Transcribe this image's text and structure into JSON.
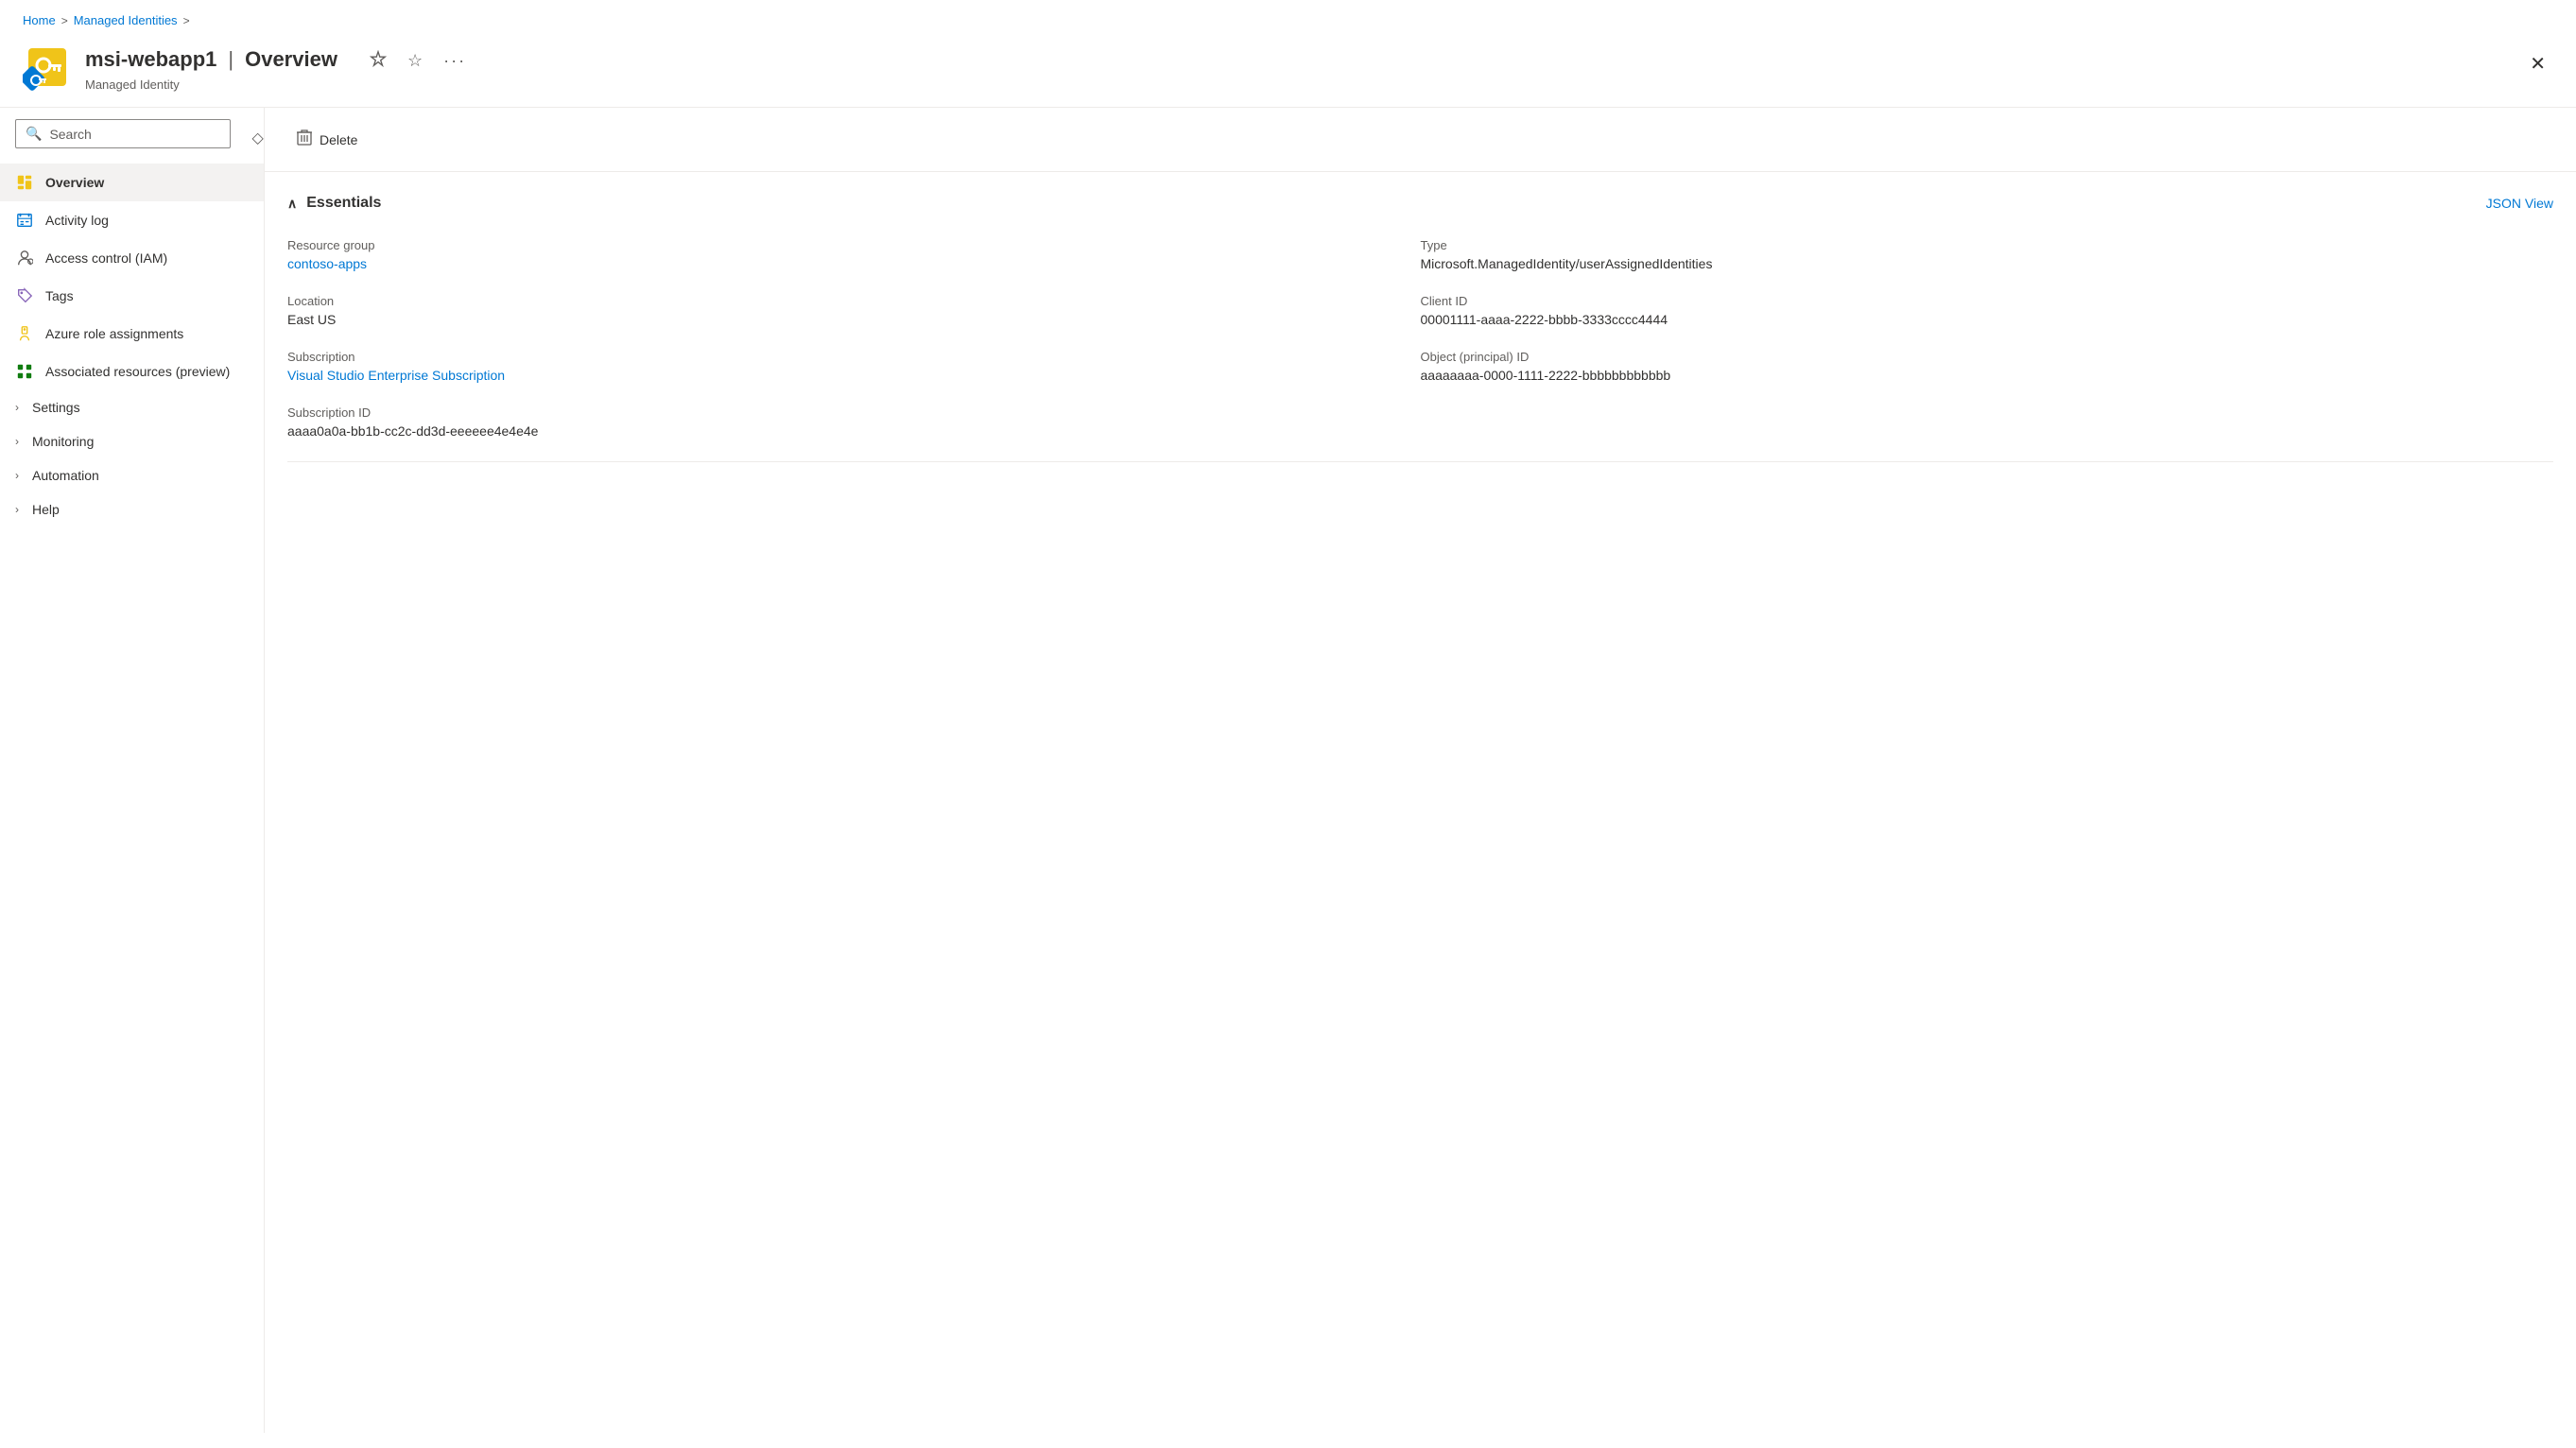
{
  "breadcrumb": {
    "home": "Home",
    "managed_identities": "Managed Identities",
    "sep": ">"
  },
  "header": {
    "title": "msi-webapp1",
    "separator": "|",
    "page": "Overview",
    "subtitle": "Managed Identity",
    "pin_icon": "📌",
    "star_icon": "☆",
    "more_icon": "···",
    "close_icon": "✕"
  },
  "sidebar": {
    "search_placeholder": "Search",
    "nav_items": [
      {
        "id": "overview",
        "label": "Overview",
        "icon": "key",
        "active": true
      },
      {
        "id": "activity-log",
        "label": "Activity log",
        "icon": "list"
      },
      {
        "id": "access-control",
        "label": "Access control (IAM)",
        "icon": "person"
      },
      {
        "id": "tags",
        "label": "Tags",
        "icon": "tag"
      },
      {
        "id": "azure-role-assignments",
        "label": "Azure role assignments",
        "icon": "key-small"
      },
      {
        "id": "associated-resources",
        "label": "Associated resources (preview)",
        "icon": "grid"
      }
    ],
    "expandable_items": [
      {
        "id": "settings",
        "label": "Settings"
      },
      {
        "id": "monitoring",
        "label": "Monitoring"
      },
      {
        "id": "automation",
        "label": "Automation"
      },
      {
        "id": "help",
        "label": "Help"
      }
    ]
  },
  "toolbar": {
    "delete_label": "Delete",
    "delete_icon": "🗑"
  },
  "essentials": {
    "title": "Essentials",
    "json_view_label": "JSON View",
    "fields": [
      {
        "label": "Resource group",
        "value": "contoso-apps",
        "is_link": true,
        "link_href": "#"
      },
      {
        "label": "Type",
        "value": "Microsoft.ManagedIdentity/userAssignedIdentities",
        "is_link": false
      },
      {
        "label": "Location",
        "value": "East US",
        "is_link": false
      },
      {
        "label": "Client ID",
        "value": "00001111-aaaa-2222-bbbb-3333cccc4444",
        "is_link": false
      },
      {
        "label": "Subscription",
        "value": "Visual Studio Enterprise Subscription",
        "is_link": true,
        "link_href": "#"
      },
      {
        "label": "Object (principal) ID",
        "value": "aaaaaaaa-0000-1111-2222-bbbbbbbbbbbb",
        "is_link": false
      },
      {
        "label": "Subscription ID",
        "value": "aaaa0a0a-bb1b-cc2c-dd3d-eeeeee4e4e4e",
        "is_link": false,
        "full_width": true
      }
    ]
  }
}
